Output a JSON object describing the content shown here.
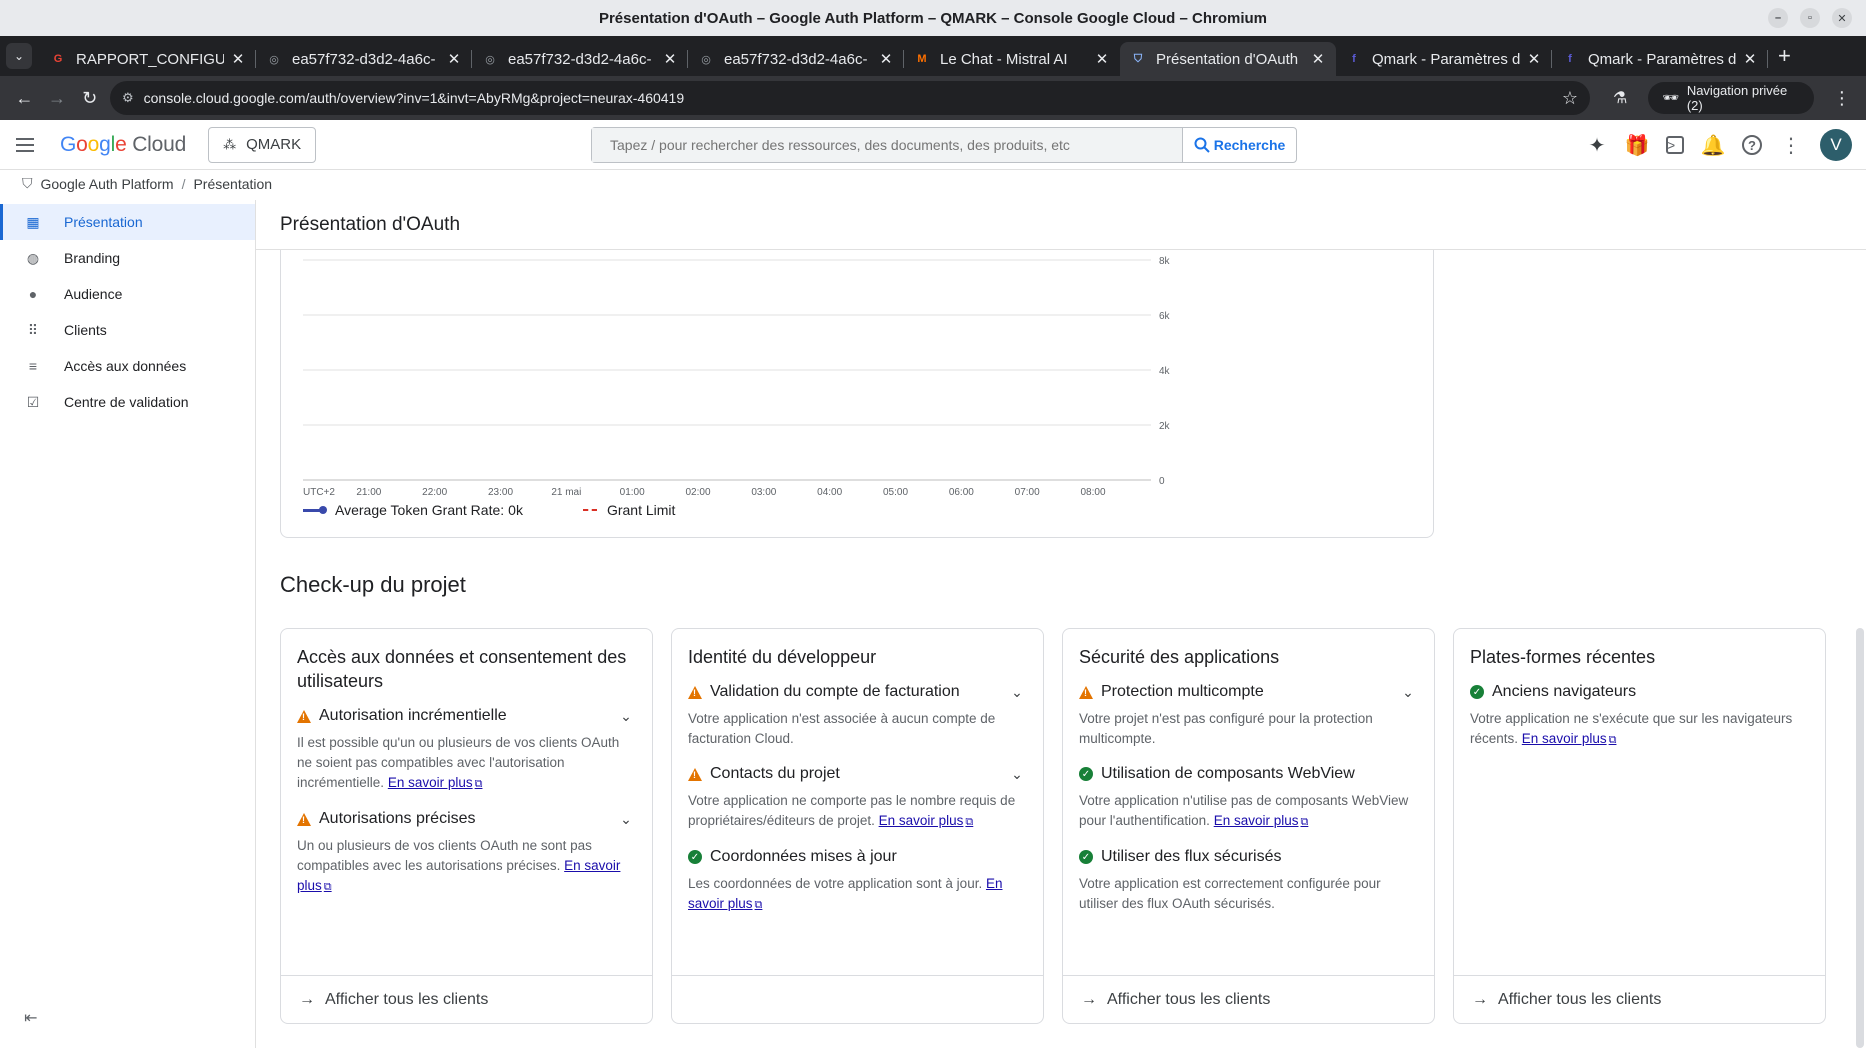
{
  "window": {
    "title": "Présentation d'OAuth – Google Auth Platform – QMARK – Console Google Cloud – Chromium"
  },
  "tabs": [
    {
      "label": "RAPPORT_CONFIGURATION",
      "favicon": "G",
      "favicon_color": "#ea4335"
    },
    {
      "label": "ea57f732-d3d2-4a6c-",
      "favicon": "◎",
      "favicon_color": "#9aa0a6"
    },
    {
      "label": "ea57f732-d3d2-4a6c-",
      "favicon": "◎",
      "favicon_color": "#9aa0a6"
    },
    {
      "label": "ea57f732-d3d2-4a6c-",
      "favicon": "◎",
      "favicon_color": "#9aa0a6"
    },
    {
      "label": "Le Chat - Mistral AI",
      "favicon": "M",
      "favicon_color": "#ff7000"
    },
    {
      "label": "Présentation d'OAuth",
      "favicon": "⛉",
      "favicon_color": "#8ab4f8",
      "active": true
    },
    {
      "label": "Qmark - Paramètres d",
      "favicon": "f",
      "favicon_color": "#5b5bd6"
    },
    {
      "label": "Qmark - Paramètres d",
      "favicon": "f",
      "favicon_color": "#5b5bd6"
    }
  ],
  "toolbar": {
    "url": "console.cloud.google.com/auth/overview?inv=1&invt=AbyRMg&project=neurax-460419",
    "incognito_label": "Navigation privée (2)"
  },
  "header": {
    "logo_google": "Google",
    "logo_cloud": "Cloud",
    "project": "QMARK",
    "search_placeholder": "Tapez / pour rechercher des ressources, des documents, des produits, etc",
    "search_button": "Recherche",
    "avatar_letter": "V"
  },
  "breadcrumb": {
    "root": "Google Auth Platform",
    "current": "Présentation"
  },
  "sidebar": {
    "items": [
      {
        "label": "Présentation",
        "icon": "dashboard-icon",
        "active": true
      },
      {
        "label": "Branding",
        "icon": "palette-icon"
      },
      {
        "label": "Audience",
        "icon": "person-icon"
      },
      {
        "label": "Clients",
        "icon": "apps-icon"
      },
      {
        "label": "Accès aux données",
        "icon": "data-access-icon"
      },
      {
        "label": "Centre de validation",
        "icon": "checklist-icon"
      }
    ]
  },
  "page": {
    "title": "Présentation d'OAuth",
    "section_title": "Check-up du projet"
  },
  "chart_data": {
    "type": "line",
    "x": [
      "UTC+2",
      "21:00",
      "22:00",
      "23:00",
      "21 mai",
      "01:00",
      "02:00",
      "03:00",
      "04:00",
      "05:00",
      "06:00",
      "07:00",
      "08:00"
    ],
    "y_ticks": [
      "8k",
      "6k",
      "4k",
      "2k",
      "0"
    ],
    "ylim": [
      0,
      8000
    ],
    "series": [
      {
        "name": "Average Token Grant Rate:",
        "value_label": "0k",
        "color": "#3949ab",
        "values": []
      },
      {
        "name": "Grant Limit",
        "color": "#d93025",
        "style": "dashed",
        "values": []
      }
    ],
    "grid": true,
    "legend_position": "bottom-left"
  },
  "cards": [
    {
      "title": "Accès aux données et consentement des utilisateurs",
      "items": [
        {
          "status": "warning",
          "title": "Autorisation incrémentielle",
          "expandable": true,
          "desc": "Il est possible qu'un ou plusieurs de vos clients OAuth ne soient pas compatibles avec l'autorisation incrémentielle.",
          "link": "En savoir plus"
        },
        {
          "status": "warning",
          "title": "Autorisations précises",
          "expandable": true,
          "desc": "Un ou plusieurs de vos clients OAuth ne sont pas compatibles avec les autorisations précises.",
          "link": "En savoir plus"
        }
      ],
      "footer": "Afficher tous les clients"
    },
    {
      "title": "Identité du développeur",
      "items": [
        {
          "status": "warning",
          "title": "Validation du compte de facturation",
          "expandable": true,
          "desc": "Votre application n'est associée à aucun compte de facturation Cloud.",
          "link": ""
        },
        {
          "status": "warning",
          "title": "Contacts du projet",
          "expandable": true,
          "desc": "Votre application ne comporte pas le nombre requis de propriétaires/éditeurs de projet.",
          "link": "En savoir plus"
        },
        {
          "status": "ok",
          "title": "Coordonnées mises à jour",
          "expandable": false,
          "desc": "Les coordonnées de votre application sont à jour.",
          "link": "En savoir plus"
        }
      ],
      "footer": ""
    },
    {
      "title": "Sécurité des applications",
      "items": [
        {
          "status": "warning",
          "title": "Protection multicompte",
          "expandable": true,
          "desc": "Votre projet n'est pas configuré pour la protection multicompte.",
          "link": ""
        },
        {
          "status": "ok",
          "title": "Utilisation de composants WebView",
          "expandable": false,
          "desc": "Votre application n'utilise pas de composants WebView pour l'authentification.",
          "link": "En savoir plus"
        },
        {
          "status": "ok",
          "title": "Utiliser des flux sécurisés",
          "expandable": false,
          "desc": "Votre application est correctement configurée pour utiliser des flux OAuth sécurisés.",
          "link": ""
        }
      ],
      "footer": "Afficher tous les clients"
    },
    {
      "title": "Plates-formes récentes",
      "items": [
        {
          "status": "ok",
          "title": "Anciens navigateurs",
          "expandable": false,
          "desc": "Votre application ne s'exécute que sur les navigateurs récents.",
          "link": "En savoir plus"
        }
      ],
      "footer": "Afficher tous les clients"
    }
  ]
}
